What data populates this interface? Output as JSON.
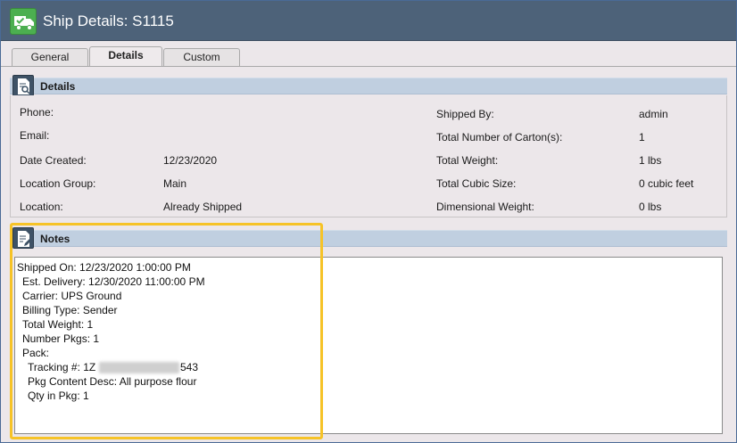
{
  "window": {
    "title": "Ship Details: S1115"
  },
  "tabs": [
    {
      "label": "General"
    },
    {
      "label": "Details"
    },
    {
      "label": "Custom"
    }
  ],
  "details_section": {
    "title": "Details"
  },
  "details": {
    "phone": {
      "label": "Phone:",
      "value": ""
    },
    "email": {
      "label": "Email:",
      "value": ""
    },
    "date_created": {
      "label": "Date Created:",
      "value": "12/23/2020"
    },
    "location_group": {
      "label": "Location Group:",
      "value": "Main"
    },
    "location": {
      "label": "Location:",
      "value": "Already Shipped"
    },
    "shipped_by": {
      "label": "Shipped By:",
      "value": "admin"
    },
    "cartons": {
      "label": "Total Number of Carton(s):",
      "value": "1"
    },
    "total_weight": {
      "label": "Total Weight:",
      "value": "1 lbs"
    },
    "cubic_size": {
      "label": "Total Cubic Size:",
      "value": "0 cubic feet"
    },
    "dimensional_weight": {
      "label": "Dimensional Weight:",
      "value": "0 lbs"
    }
  },
  "notes_section": {
    "title": "Notes"
  },
  "notes": {
    "lines": [
      "Shipped On: 12/23/2020 1:00:00 PM",
      "Est. Delivery: 12/30/2020 11:00:00 PM",
      "Carrier: UPS Ground",
      "Billing Type: Sender",
      "Total Weight: 1",
      "Number Pkgs: 1",
      "Pack:",
      "Tracking #: 1Z",
      "Pkg Content Desc: All purpose flour",
      "Qty in Pkg: 1"
    ],
    "tracking_suffix": "543"
  },
  "colors": {
    "titlebar": "#4d6279",
    "title_icon": "#4caf50",
    "section_header": "#c0cfe0",
    "highlight": "#f6c327"
  },
  "icons": {
    "title": "truck-check-icon",
    "details": "document-search-icon",
    "notes": "document-edit-icon"
  }
}
